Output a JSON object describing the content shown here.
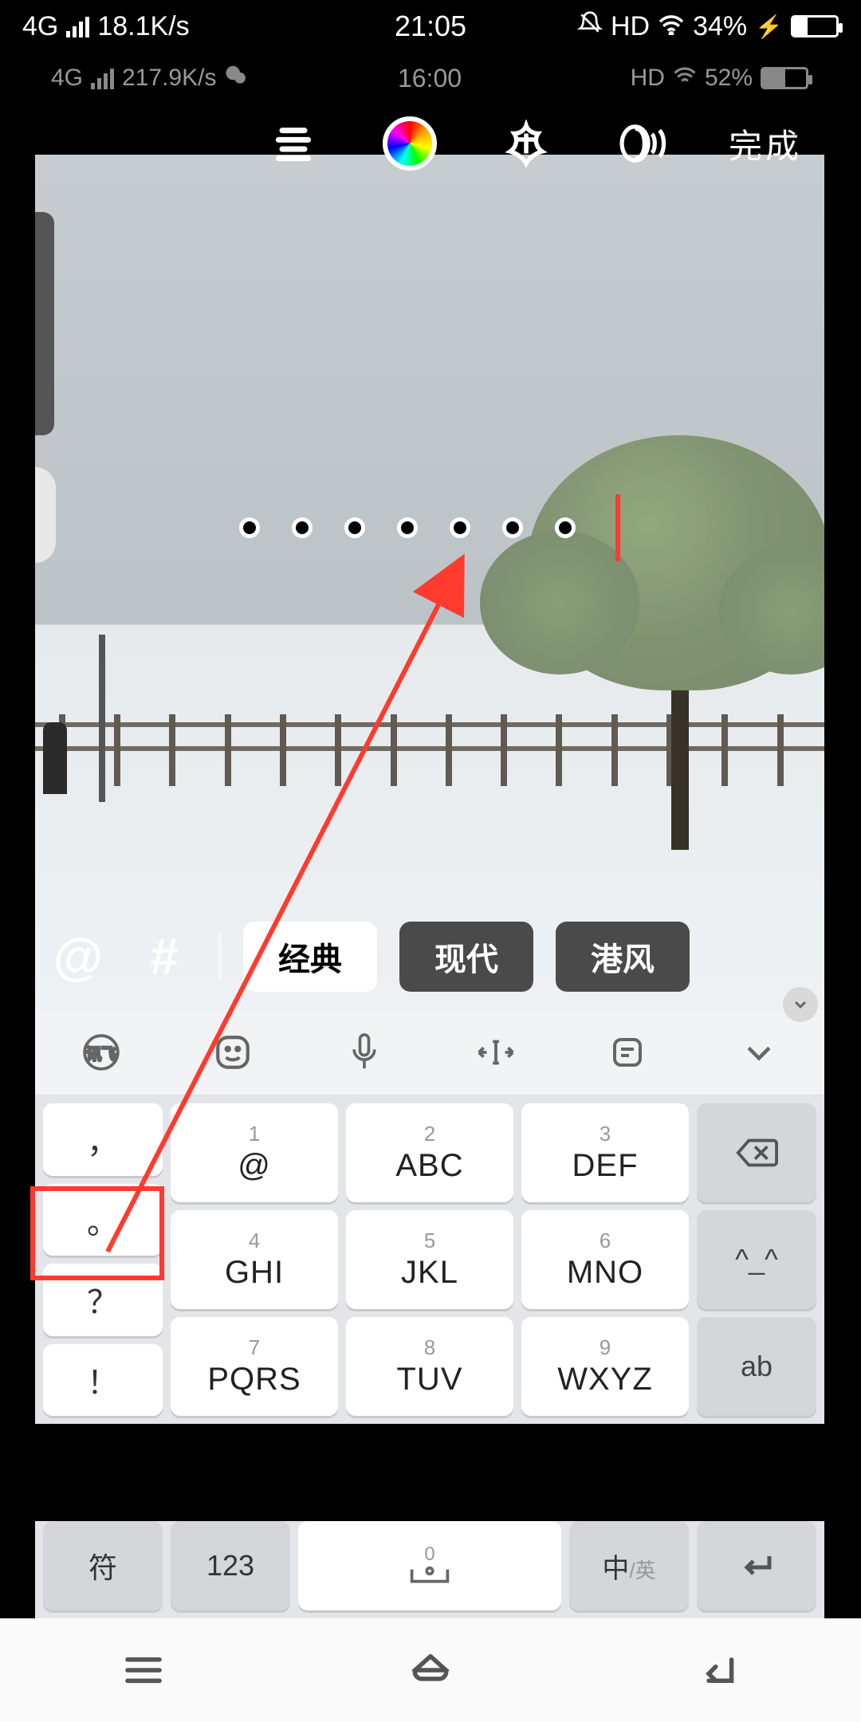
{
  "outer_status": {
    "network": "4G",
    "speed": "18.1K/s",
    "time": "21:05",
    "hd": "HD",
    "battery_pct": "34%",
    "battery_fill": 34
  },
  "inner_status": {
    "network": "4G",
    "speed": "217.9K/s",
    "time": "16:00",
    "hd": "HD",
    "battery_pct": "52%",
    "battery_fill": 52
  },
  "toolbar": {
    "done": "完成"
  },
  "text_input": {
    "content": "。。。。。。。",
    "dot_count": 7
  },
  "style_bar": {
    "at": "@",
    "hash": "#",
    "tabs": [
      {
        "label": "经典",
        "active": true
      },
      {
        "label": "现代",
        "active": false
      },
      {
        "label": "港风",
        "active": false
      }
    ]
  },
  "kb_toolbar_icons": [
    "ime-logo",
    "sticker",
    "mic",
    "cursor-move",
    "clipboard",
    "collapse"
  ],
  "keyboard": {
    "punct": [
      "，",
      "。",
      "？",
      "！"
    ],
    "keys": [
      {
        "num": "1",
        "lab": "@"
      },
      {
        "num": "2",
        "lab": "ABC"
      },
      {
        "num": "3",
        "lab": "DEF"
      },
      {
        "num": "4",
        "lab": "GHI"
      },
      {
        "num": "5",
        "lab": "JKL"
      },
      {
        "num": "6",
        "lab": "MNO"
      },
      {
        "num": "7",
        "lab": "PQRS"
      },
      {
        "num": "8",
        "lab": "TUV"
      },
      {
        "num": "9",
        "lab": "WXYZ"
      }
    ],
    "side": {
      "backspace": "⌫",
      "emoji": "^_^",
      "ab": "ab"
    },
    "bottom": {
      "sym": "符",
      "num": "123",
      "space_num": "0",
      "space_icon": "⎵",
      "lang_main": "中",
      "lang_sub": "/英",
      "enter": "↵"
    }
  },
  "annotation": {
    "highlight_key_index": 1
  }
}
